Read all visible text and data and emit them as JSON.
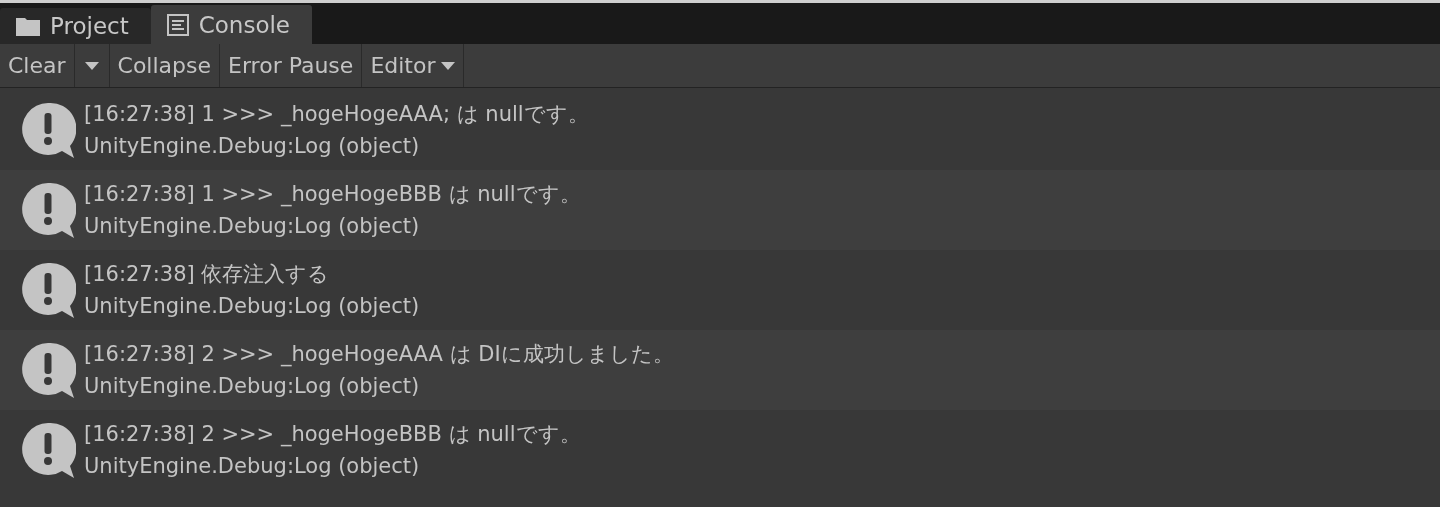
{
  "tabs": [
    {
      "label": "Project",
      "kind": "folder",
      "selected": false
    },
    {
      "label": "Console",
      "kind": "console",
      "selected": true
    }
  ],
  "toolbar": [
    {
      "label": "Clear",
      "kind": "split"
    },
    {
      "label": "Collapse",
      "kind": "button"
    },
    {
      "label": "Error Pause",
      "kind": "button"
    },
    {
      "label": "Editor",
      "kind": "dropdown"
    }
  ],
  "log_entries": [
    {
      "message": "[16:27:38] 1 >>> _hogeHogeAAA; は nullです。",
      "stack": "UnityEngine.Debug:Log (object)"
    },
    {
      "message": "[16:27:38] 1 >>> _hogeHogeBBB は nullです。",
      "stack": "UnityEngine.Debug:Log (object)"
    },
    {
      "message": "[16:27:38] 依存注入する",
      "stack": "UnityEngine.Debug:Log (object)"
    },
    {
      "message": "[16:27:38] 2 >>> _hogeHogeAAA は DIに成功しました。",
      "stack": "UnityEngine.Debug:Log (object)"
    },
    {
      "message": "[16:27:38] 2 >>> _hogeHogeBBB は nullです。",
      "stack": "UnityEngine.Debug:Log (object)"
    }
  ]
}
